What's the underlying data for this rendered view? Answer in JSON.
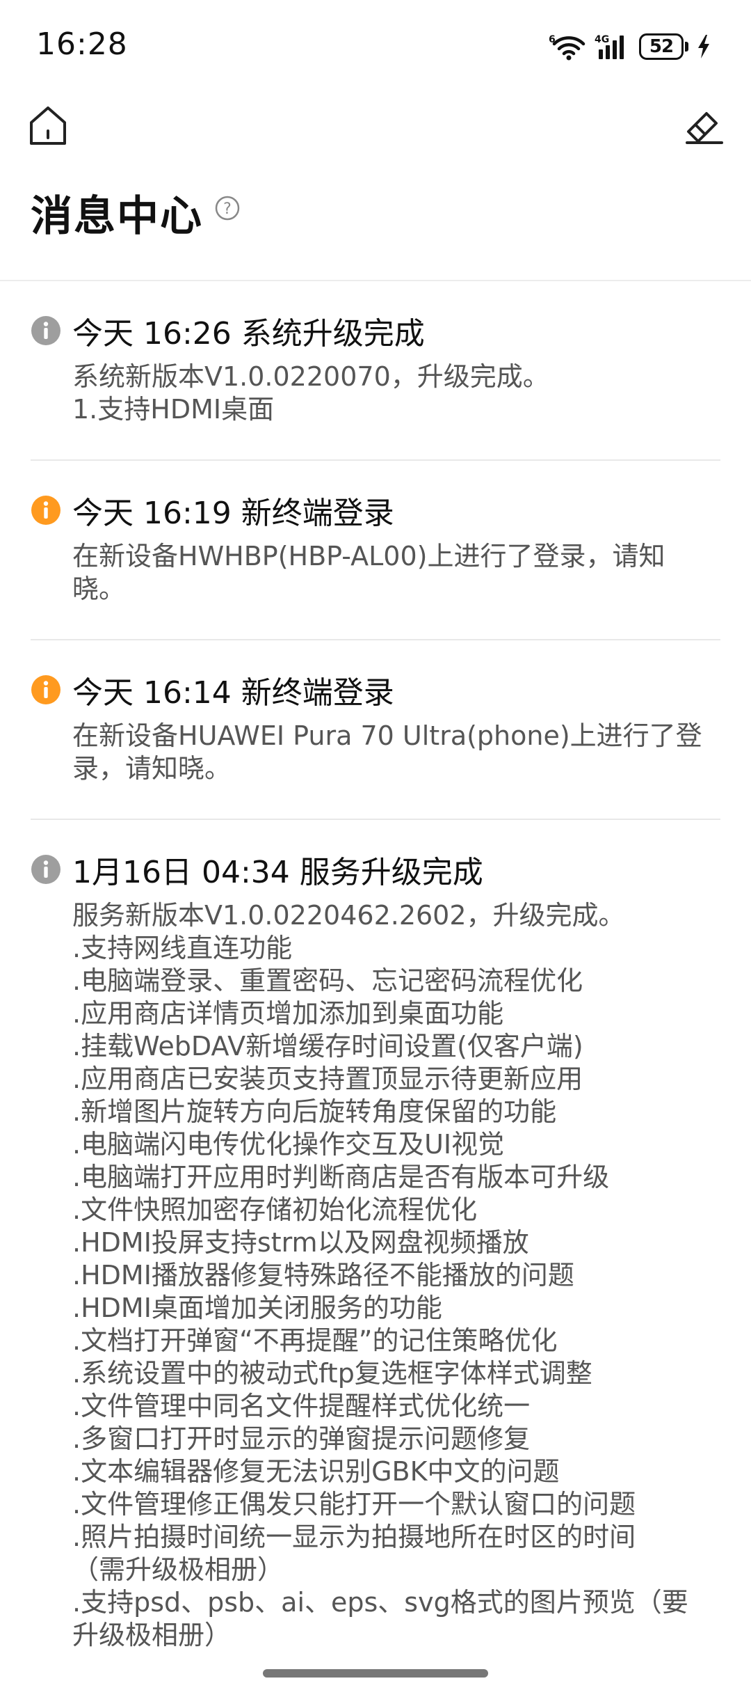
{
  "status_bar": {
    "time": "16:28",
    "network_label": "4G",
    "wifi_badge": "6",
    "battery": "52"
  },
  "header": {
    "title": "消息中心",
    "help_symbol": "?"
  },
  "colors": {
    "info": "#9e9e9e",
    "warning": "#ff9a1f"
  },
  "messages": [
    {
      "icon": "info-icon",
      "title": "今天 16:26 系统升级完成",
      "body": [
        "系统新版本V1.0.0220070，升级完成。",
        "1.支持HDMI桌面"
      ]
    },
    {
      "icon": "warning-icon",
      "title": "今天 16:19 新终端登录",
      "body": [
        "在新设备HWHBP(HBP-AL00)上进行了登录，请知",
        "晓。"
      ]
    },
    {
      "icon": "warning-icon",
      "title": "今天 16:14 新终端登录",
      "body": [
        "在新设备HUAWEI Pura 70 Ultra(phone)上进行了登",
        "录，请知晓。"
      ]
    },
    {
      "icon": "info-icon",
      "title": "1月16日 04:34 服务升级完成",
      "body": [
        "服务新版本V1.0.0220462.2602，升级完成。",
        ".支持网线直连功能",
        ".电脑端登录、重置密码、忘记密码流程优化",
        ".应用商店详情页增加添加到桌面功能",
        ".挂载WebDAV新增缓存时间设置(仅客户端)",
        ".应用商店已安装页支持置顶显示待更新应用",
        ".新增图片旋转方向后旋转角度保留的功能",
        ".电脑端闪电传优化操作交互及UI视觉",
        ".电脑端打开应用时判断商店是否有版本可升级",
        ".文件快照加密存储初始化流程优化",
        ".HDMI投屏支持strm以及网盘视频播放",
        ".HDMI播放器修复特殊路径不能播放的问题",
        ".HDMI桌面增加关闭服务的功能",
        ".文档打开弹窗“不再提醒”的记住策略优化",
        ".系统设置中的被动式ftp复选框字体样式调整",
        ".文件管理中同名文件提醒样式优化统一",
        ".多窗口打开时显示的弹窗提示问题修复",
        ".文本编辑器修复无法识别GBK中文的问题",
        ".文件管理修正偶发只能打开一个默认窗口的问题",
        ".照片拍摄时间统一显示为拍摄地所在时区的时间",
        "（需升级极相册）",
        ".支持psd、psb、ai、eps、svg格式的图片预览（要",
        "升级极相册）"
      ]
    }
  ]
}
